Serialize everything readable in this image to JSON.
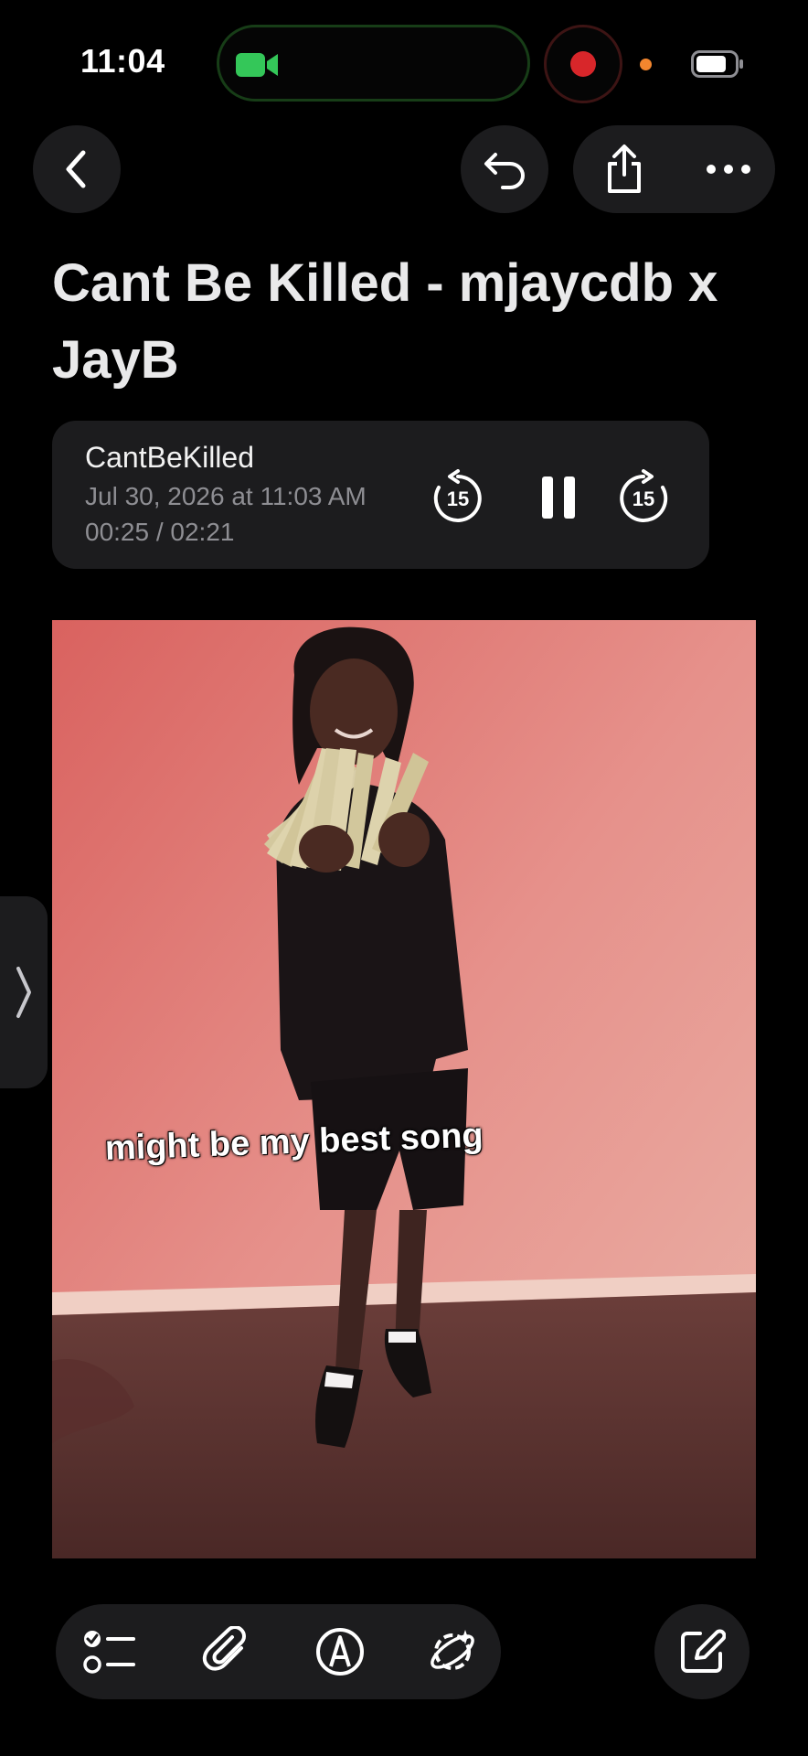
{
  "status_bar": {
    "time": "11:04",
    "icons": [
      "facetime-camera-icon",
      "screen-record-icon",
      "microphone-indicator-icon",
      "battery-icon"
    ],
    "colors": {
      "camera": "#34c759",
      "record": "#d8262a",
      "mic_dot": "#f3862e"
    }
  },
  "nav": {
    "icons": [
      "chevron-left-icon",
      "undo-icon",
      "share-icon",
      "more-icon"
    ]
  },
  "note": {
    "title": "Cant Be Killed - mjaycdb x JayB"
  },
  "audio": {
    "name": "CantBeKilled",
    "date": "Jul 30, 2026 at 11:03 AM",
    "time": "00:25 / 02:21",
    "skip_back": "15",
    "skip_forward": "15",
    "state": "playing"
  },
  "photo": {
    "caption": "might be my best song"
  },
  "toolbar": {
    "icons": [
      "checklist-icon",
      "paperclip-icon",
      "markup-pen-icon",
      "apple-intelligence-icon",
      "compose-icon"
    ]
  }
}
